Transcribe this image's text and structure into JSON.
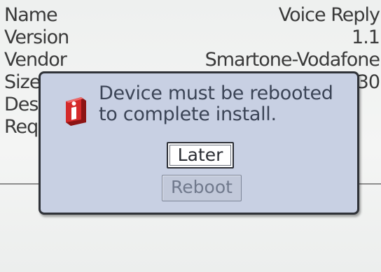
{
  "details": [
    {
      "label": "Name",
      "value": "Voice Reply"
    },
    {
      "label": "Version",
      "value": "1.1"
    },
    {
      "label": "Vendor",
      "value": "Smartone-Vodafone"
    },
    {
      "label": "Size",
      "value": "30"
    },
    {
      "label": "Description",
      "value": ""
    },
    {
      "label": "Requires",
      "value": ""
    }
  ],
  "dialog": {
    "icon": "info-icon",
    "message_line1": "Device must be rebooted",
    "message_line2": "to complete install.",
    "later_label": "Later",
    "reboot_label": "Reboot"
  },
  "colors": {
    "dialog_background": "#c8d0e3",
    "dialog_border": "#2f3238",
    "icon_red": "#d42a2a"
  }
}
